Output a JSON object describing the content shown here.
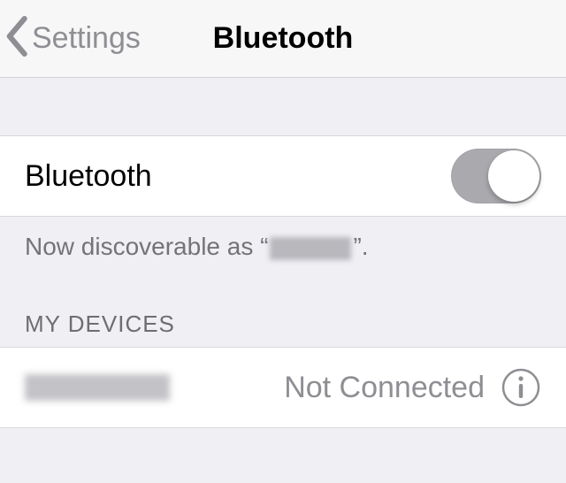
{
  "header": {
    "back_label": "Settings",
    "title": "Bluetooth"
  },
  "bluetooth": {
    "label": "Bluetooth",
    "enabled": true
  },
  "discoverable": {
    "prefix": "Now discoverable as “",
    "suffix": "”."
  },
  "sections": {
    "my_devices": "MY DEVICES"
  },
  "devices": [
    {
      "status": "Not Connected"
    }
  ]
}
